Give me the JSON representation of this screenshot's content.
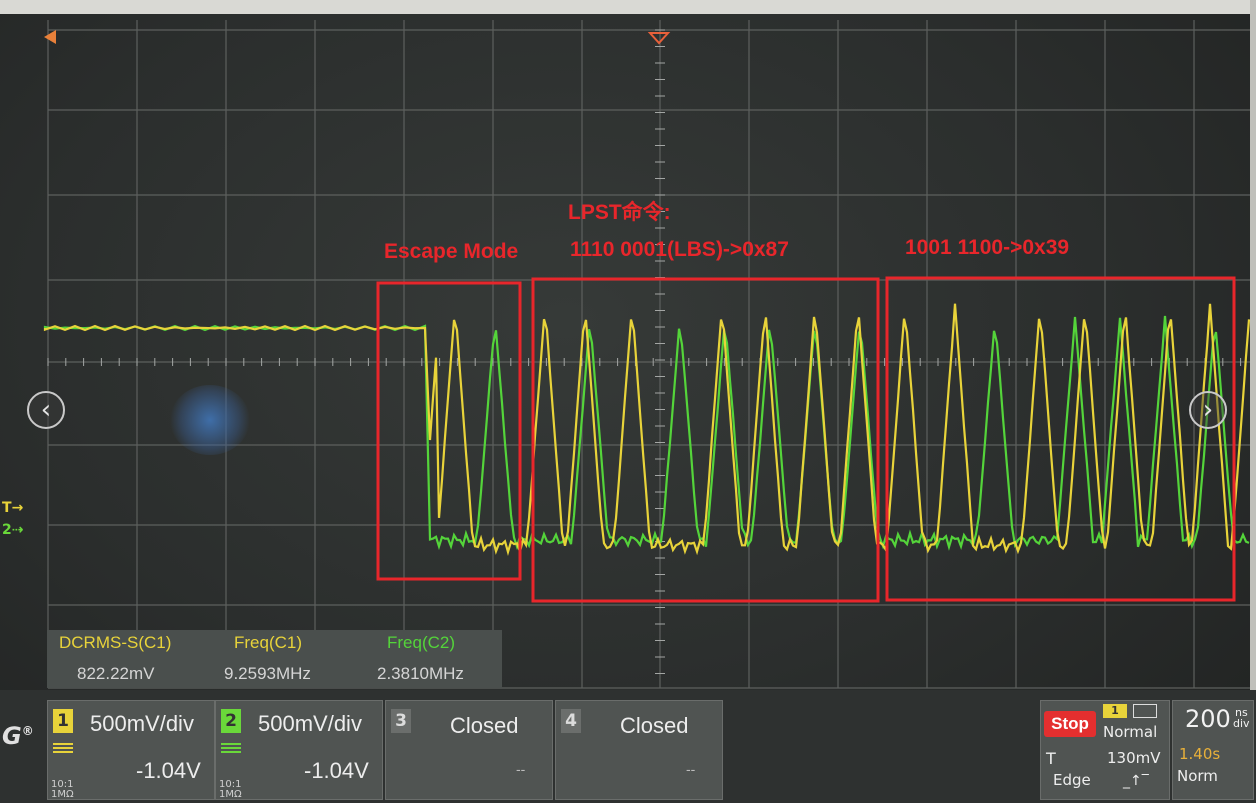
{
  "annotations": {
    "escape": "Escape Mode",
    "lpst": "LPST命令:",
    "cmd1": "1110 0001(LBS)->0x87",
    "cmd2": "1001 1100->0x39"
  },
  "markers": {
    "trigger": "T",
    "ch2": "2"
  },
  "measurements": [
    {
      "label": "DCRMS-S(C1)",
      "value": "822.22mV",
      "color": "#e8d33a"
    },
    {
      "label": "Freq(C1)",
      "value": "9.2593MHz",
      "color": "#e8d33a"
    },
    {
      "label": "Freq(C2)",
      "value": "2.3810MHz",
      "color": "#54d43a"
    }
  ],
  "channels": [
    {
      "num": "1",
      "scale": "500mV/div",
      "offset": "-1.04V",
      "coupling": "10:1",
      "impedance": "1MΩ",
      "color": "#e8d33a"
    },
    {
      "num": "2",
      "scale": "500mV/div",
      "offset": "-1.04V",
      "coupling": "10:1",
      "impedance": "1MΩ",
      "color": "#6ad83a"
    },
    {
      "num": "3",
      "status": "Closed",
      "offset": "--"
    },
    {
      "num": "4",
      "status": "Closed",
      "offset": "--"
    }
  ],
  "trigger": {
    "state": "Stop",
    "source": "1",
    "mode": "Normal",
    "label": "T",
    "level": "130mV",
    "type": "Edge"
  },
  "timebase": {
    "value": "200",
    "unit": "ns",
    "unit2": "div",
    "delay": "1.40s",
    "acq": "Norm"
  },
  "colors": {
    "ch1": "#e8d33a",
    "ch2": "#54d43a",
    "annotation": "#e8262b"
  },
  "icons": [
    "left-arrow-icon",
    "right-arrow-icon",
    "brand-logo-icon",
    "stop-icon"
  ]
}
